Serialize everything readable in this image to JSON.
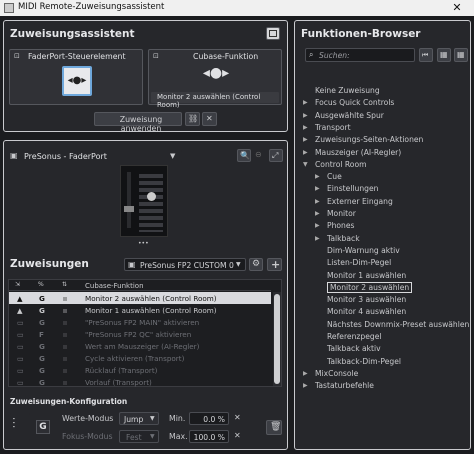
{
  "window": {
    "title": "MIDI Remote-Zuweisungsassistent",
    "close_glyph": "✕"
  },
  "assistant": {
    "title": "Zuweisungsassistent",
    "faderport_label": "FaderPort-Steuerelement",
    "cubase_label": "Cubase-Funktion",
    "cubase_value": "Monitor 2 auswählen (Control Room)",
    "apply_label": "Zuweisung anwenden"
  },
  "device": {
    "selected": "PreSonus - FaderPort"
  },
  "assignments": {
    "title": "Zuweisungen",
    "preset": "PreSonus FP2 CUSTOM 0",
    "column_function": "Cubase-Funktion",
    "rows": [
      {
        "flag": "G",
        "label": "Monitor 2 auswählen (Control Room)",
        "selected": true,
        "dim": false
      },
      {
        "flag": "G",
        "label": "Monitor 1 auswählen (Control Room)",
        "selected": false,
        "dim": false
      },
      {
        "flag": "G",
        "label": "\"PreSonus FP2 MAIN\" aktivieren",
        "selected": false,
        "dim": true
      },
      {
        "flag": "F",
        "label": "\"PreSonus FP2 QC\" aktivieren",
        "selected": false,
        "dim": true
      },
      {
        "flag": "G",
        "label": "Wert am Mauszeiger (AI-Regler)",
        "selected": false,
        "dim": true
      },
      {
        "flag": "G",
        "label": "Cycle aktivieren (Transport)",
        "selected": false,
        "dim": true
      },
      {
        "flag": "G",
        "label": "Rücklauf (Transport)",
        "selected": false,
        "dim": true
      },
      {
        "flag": "G",
        "label": "Vorlauf (Transport)",
        "selected": false,
        "dim": true
      }
    ]
  },
  "config": {
    "title": "Zuweisungen-Konfiguration",
    "mode_label": "Werte-Modus",
    "mode_value": "Jump",
    "focus_label": "Fokus-Modus",
    "focus_value": "Fest",
    "min_label": "Min.",
    "min_value": "0.0 %",
    "max_label": "Max.",
    "max_value": "100.0 %",
    "g_badge": "G"
  },
  "browser": {
    "title": "Funktionen-Browser",
    "search_placeholder": "Suchen:",
    "tree": [
      {
        "label": "Keine Zuweisung",
        "depth": 0,
        "arrow": ""
      },
      {
        "label": "Focus Quick Controls",
        "depth": 0,
        "arrow": "▶"
      },
      {
        "label": "Ausgewählte Spur",
        "depth": 0,
        "arrow": "▶"
      },
      {
        "label": "Transport",
        "depth": 0,
        "arrow": "▶"
      },
      {
        "label": "Zuweisungs-Seiten-Aktionen",
        "depth": 0,
        "arrow": "▶"
      },
      {
        "label": "Mauszeiger (AI-Regler)",
        "depth": 0,
        "arrow": "▶"
      },
      {
        "label": "Control Room",
        "depth": 0,
        "arrow": "▼"
      },
      {
        "label": "Cue",
        "depth": 1,
        "arrow": "▶"
      },
      {
        "label": "Einstellungen",
        "depth": 1,
        "arrow": "▶"
      },
      {
        "label": "Externer Eingang",
        "depth": 1,
        "arrow": "▶"
      },
      {
        "label": "Monitor",
        "depth": 1,
        "arrow": "▶"
      },
      {
        "label": "Phones",
        "depth": 1,
        "arrow": "▶"
      },
      {
        "label": "Talkback",
        "depth": 1,
        "arrow": "▶"
      },
      {
        "label": "Dim-Warnung aktiv",
        "depth": 1,
        "arrow": ""
      },
      {
        "label": "Listen-Dim-Pegel",
        "depth": 1,
        "arrow": ""
      },
      {
        "label": "Monitor 1 auswählen",
        "depth": 1,
        "arrow": ""
      },
      {
        "label": "Monitor 2 auswählen",
        "depth": 1,
        "arrow": "",
        "selected": true
      },
      {
        "label": "Monitor 3 auswählen",
        "depth": 1,
        "arrow": ""
      },
      {
        "label": "Monitor 4 auswählen",
        "depth": 1,
        "arrow": ""
      },
      {
        "label": "Nächstes Downmix-Preset auswählen",
        "depth": 1,
        "arrow": ""
      },
      {
        "label": "Referenzpegel",
        "depth": 1,
        "arrow": ""
      },
      {
        "label": "Talkback aktiv",
        "depth": 1,
        "arrow": ""
      },
      {
        "label": "Talkback-Dim-Pegel",
        "depth": 1,
        "arrow": ""
      },
      {
        "label": "MixConsole",
        "depth": 0,
        "arrow": "▶"
      },
      {
        "label": "Tastaturbefehle",
        "depth": 0,
        "arrow": "▶"
      }
    ]
  },
  "colors": {
    "panel_border": "#c9cace",
    "selection": "#d9dade",
    "background": "#1b1c1f"
  }
}
